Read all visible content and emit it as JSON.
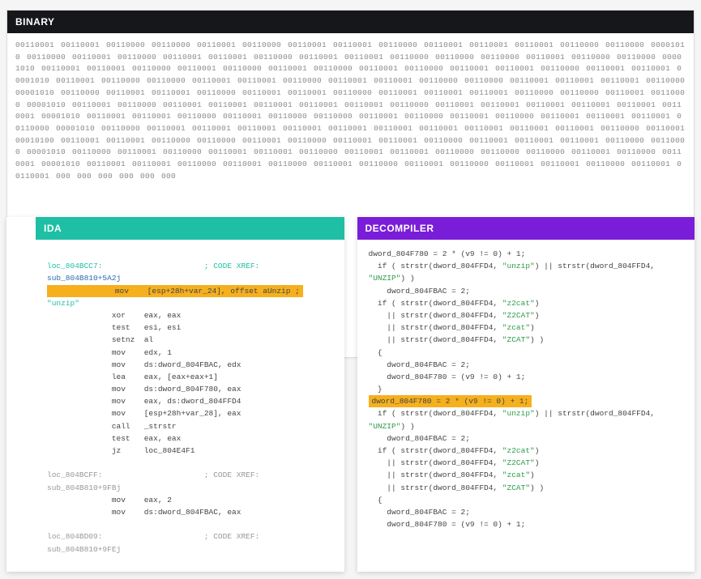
{
  "binary": {
    "title": "BINARY",
    "rows": [
      "00110001 00110001 00110000 00110000 00110001 00110000 00110001 00110001 00110000 00110001 00110001 00110001 00110000 00110000 00001010",
      "00110000 00110001 00110000 00110001 00110001 00110000 00110001 00110001 00110000 00110000 00110000 00110001 00110000 00110000 00001010",
      "00110001 00110001 00110000 00110001 00110000 00110001 00110000 00110001 00110000 00110001 00110001 00110000 00110001 00110001 00001010",
      "00110001 00110000 00110000 00110001 00110001 00110000 00110001 00110001 00110000 00110000 00110001 00110001 00110001 00110000 00001010",
      "00110000 00110001 00110001 00110000 00110001 00110001 00110000 00110001 00110001 00110001 00110000 00110000 00110001 00110000 00001010",
      "00110001 00110000 00110001 00110001 00110001 00110001 00110001 00110000 00110001 00110001 00110001 00110001 00110001 00110001 00001010",
      "00110001 00110001 00110000 00110001 00110000 00110000 00110001 00110000 00110001 00110000 00110001 00110001 00110001 00110000 00001010",
      "00110000 00110001 00110001 00110001 00110001 00110001 00110001 00110001 00110001 00110001 00110001 00110000 00110001",
      "00010100 00110001 00110001 00110000 00110000 00110001 00110000 00110001 00110001 00110000 00110001 00110001 00110001 00110000 00110000",
      "00001010 00110000 00110001 00110000 00110001 00110001 00110000 00110001 00110001 00110000 00110000 00110000 00110001 00110000 00110001",
      "00001010 00110001 00110001 00110000 00110001 00110000 00110001 00110000 00110001 00110000 00110001 00110001 00110000 00110001 00110001",
      "000",
      "000",
      "000",
      "000",
      "000",
      "000"
    ]
  },
  "ida": {
    "title": "IDA",
    "lines": [
      {
        "t": " ",
        "cls": ""
      },
      {
        "t": "loc_804BCC7:                      ; CODE XREF:",
        "cls": "teal"
      },
      {
        "t": "sub_804B810+5A2j",
        "cls": "blue"
      },
      {
        "t": "              mov    [esp+28h+var_24], offset aUnzip ;",
        "cls": "hl"
      },
      {
        "t": "\"unzip\"",
        "cls": "teal"
      },
      {
        "t": "              xor    eax, eax",
        "cls": ""
      },
      {
        "t": "              test   esi, esi",
        "cls": ""
      },
      {
        "t": "              setnz  al",
        "cls": ""
      },
      {
        "t": "              mov    edx, 1",
        "cls": ""
      },
      {
        "t": "              mov    ds:dword_804FBAC, edx",
        "cls": ""
      },
      {
        "t": "              lea    eax, [eax+eax+1]",
        "cls": ""
      },
      {
        "t": "              mov    ds:dword_804F780, eax",
        "cls": ""
      },
      {
        "t": "              mov    eax, ds:dword_804FFD4",
        "cls": ""
      },
      {
        "t": "              mov    [esp+28h+var_28], eax",
        "cls": ""
      },
      {
        "t": "              call   _strstr",
        "cls": ""
      },
      {
        "t": "              test   eax, eax",
        "cls": ""
      },
      {
        "t": "              jz     loc_804E4F1",
        "cls": ""
      },
      {
        "t": " ",
        "cls": ""
      },
      {
        "t": "loc_804BCFF:                      ; CODE XREF:",
        "cls": "gray"
      },
      {
        "t": "sub_804B810+9FBj",
        "cls": "gray"
      },
      {
        "t": "              mov    eax, 2",
        "cls": ""
      },
      {
        "t": "              mov    ds:dword_804FBAC, eax",
        "cls": ""
      },
      {
        "t": " ",
        "cls": ""
      },
      {
        "t": "loc_804BD09:                      ; CODE XREF:",
        "cls": "gray"
      },
      {
        "t": "sub_804B810+9FEj",
        "cls": "gray"
      }
    ]
  },
  "decompiler": {
    "title": "DECOMPILER",
    "lines": [
      {
        "parts": [
          {
            "t": "dword_804F780 = 2 * (v9 != 0) + 1;",
            "cls": ""
          }
        ]
      },
      {
        "parts": [
          {
            "t": "  if ( strstr(dword_804FFD4, ",
            "cls": ""
          },
          {
            "t": "\"unzip\"",
            "cls": "green"
          },
          {
            "t": ") || strstr(dword_804FFD4,",
            "cls": ""
          }
        ]
      },
      {
        "parts": [
          {
            "t": "\"UNZIP\"",
            "cls": "green"
          },
          {
            "t": ") )",
            "cls": ""
          }
        ]
      },
      {
        "parts": [
          {
            "t": "    dword_804FBAC = 2;",
            "cls": ""
          }
        ]
      },
      {
        "parts": [
          {
            "t": "  if ( strstr(dword_804FFD4, ",
            "cls": ""
          },
          {
            "t": "\"z2cat\"",
            "cls": "green"
          },
          {
            "t": ")",
            "cls": ""
          }
        ]
      },
      {
        "parts": [
          {
            "t": "    || strstr(dword_804FFD4, ",
            "cls": ""
          },
          {
            "t": "\"Z2CAT\"",
            "cls": "green"
          },
          {
            "t": ")",
            "cls": ""
          }
        ]
      },
      {
        "parts": [
          {
            "t": "    || strstr(dword_804FFD4, ",
            "cls": ""
          },
          {
            "t": "\"zcat\"",
            "cls": "green"
          },
          {
            "t": ")",
            "cls": ""
          }
        ]
      },
      {
        "parts": [
          {
            "t": "    || strstr(dword_804FFD4, ",
            "cls": ""
          },
          {
            "t": "\"ZCAT\"",
            "cls": "green"
          },
          {
            "t": ") )",
            "cls": ""
          }
        ]
      },
      {
        "parts": [
          {
            "t": "  {",
            "cls": ""
          }
        ]
      },
      {
        "parts": [
          {
            "t": "    dword_804FBAC = 2;",
            "cls": ""
          }
        ]
      },
      {
        "parts": [
          {
            "t": "    dword_804F780 = (v9 != 0) + 1;",
            "cls": ""
          }
        ]
      },
      {
        "parts": [
          {
            "t": "  }",
            "cls": ""
          }
        ]
      },
      {
        "hl": true,
        "parts": [
          {
            "t": "dword_804F780 = 2 * (v9 != 0) + 1;",
            "cls": ""
          }
        ]
      },
      {
        "parts": [
          {
            "t": "  if ( strstr(dword_804FFD4, ",
            "cls": ""
          },
          {
            "t": "\"unzip\"",
            "cls": "green"
          },
          {
            "t": ") || strstr(dword_804FFD4,",
            "cls": ""
          }
        ]
      },
      {
        "parts": [
          {
            "t": "\"UNZIP\"",
            "cls": "green"
          },
          {
            "t": ") )",
            "cls": ""
          }
        ]
      },
      {
        "parts": [
          {
            "t": "    dword_804FBAC = 2;",
            "cls": ""
          }
        ]
      },
      {
        "parts": [
          {
            "t": "  if ( strstr(dword_804FFD4, ",
            "cls": ""
          },
          {
            "t": "\"z2cat\"",
            "cls": "green"
          },
          {
            "t": ")",
            "cls": ""
          }
        ]
      },
      {
        "parts": [
          {
            "t": "    || strstr(dword_804FFD4, ",
            "cls": ""
          },
          {
            "t": "\"Z2CAT\"",
            "cls": "green"
          },
          {
            "t": ")",
            "cls": ""
          }
        ]
      },
      {
        "parts": [
          {
            "t": "    || strstr(dword_804FFD4, ",
            "cls": ""
          },
          {
            "t": "\"zcat\"",
            "cls": "green"
          },
          {
            "t": ")",
            "cls": ""
          }
        ]
      },
      {
        "parts": [
          {
            "t": "    || strstr(dword_804FFD4, ",
            "cls": ""
          },
          {
            "t": "\"ZCAT\"",
            "cls": "green"
          },
          {
            "t": ") )",
            "cls": ""
          }
        ]
      },
      {
        "parts": [
          {
            "t": "  {",
            "cls": ""
          }
        ]
      },
      {
        "parts": [
          {
            "t": "    dword_804FBAC = 2;",
            "cls": ""
          }
        ]
      },
      {
        "parts": [
          {
            "t": "    dword_804F780 = (v9 != 0) + 1;",
            "cls": ""
          }
        ]
      }
    ]
  }
}
